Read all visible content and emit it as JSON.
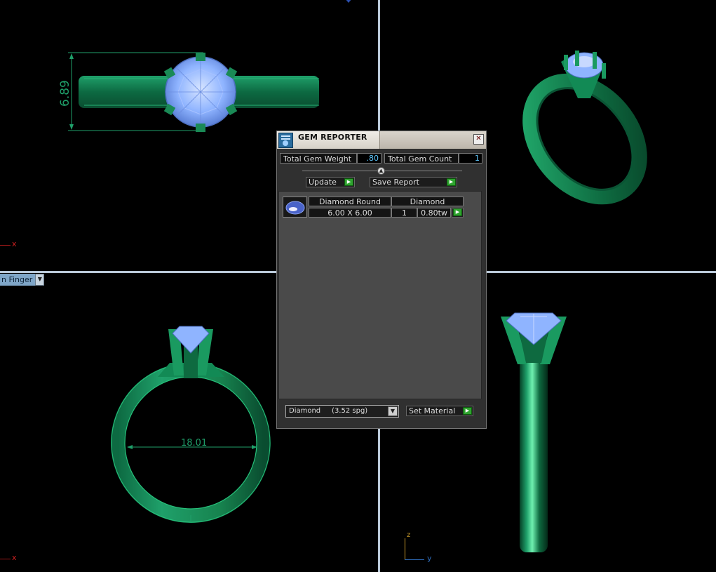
{
  "viewports": {
    "top_left": {
      "dimension": "6.89",
      "axis_label": "x"
    },
    "top_right": {},
    "bottom_left": {
      "dropdown_label": "n Finger",
      "dimension": "18.01",
      "axis_label": "x"
    },
    "bottom_right": {
      "axis_z": "z",
      "axis_y": "y"
    }
  },
  "panel": {
    "title": "GEM REPORTER",
    "close_icon": "close-icon",
    "total_weight_label": "Total Gem Weight",
    "total_weight_value": ".80",
    "total_count_label": "Total Gem Count",
    "total_count_value": "1",
    "update_label": "Update",
    "save_report_label": "Save Report",
    "gems": [
      {
        "shape": "Diamond Round",
        "material": "Diamond",
        "size": "6.00 X 6.00",
        "count": "1",
        "weight": "0.80tw"
      }
    ],
    "material_select": "Diamond     (3.52 spg)",
    "set_material_label": "Set Material"
  },
  "colors": {
    "ring_green": "#1f9a63",
    "gem_blue": "#8fb4ff",
    "divider": "#b9c8d8",
    "accent_play": "#2fa32f"
  }
}
